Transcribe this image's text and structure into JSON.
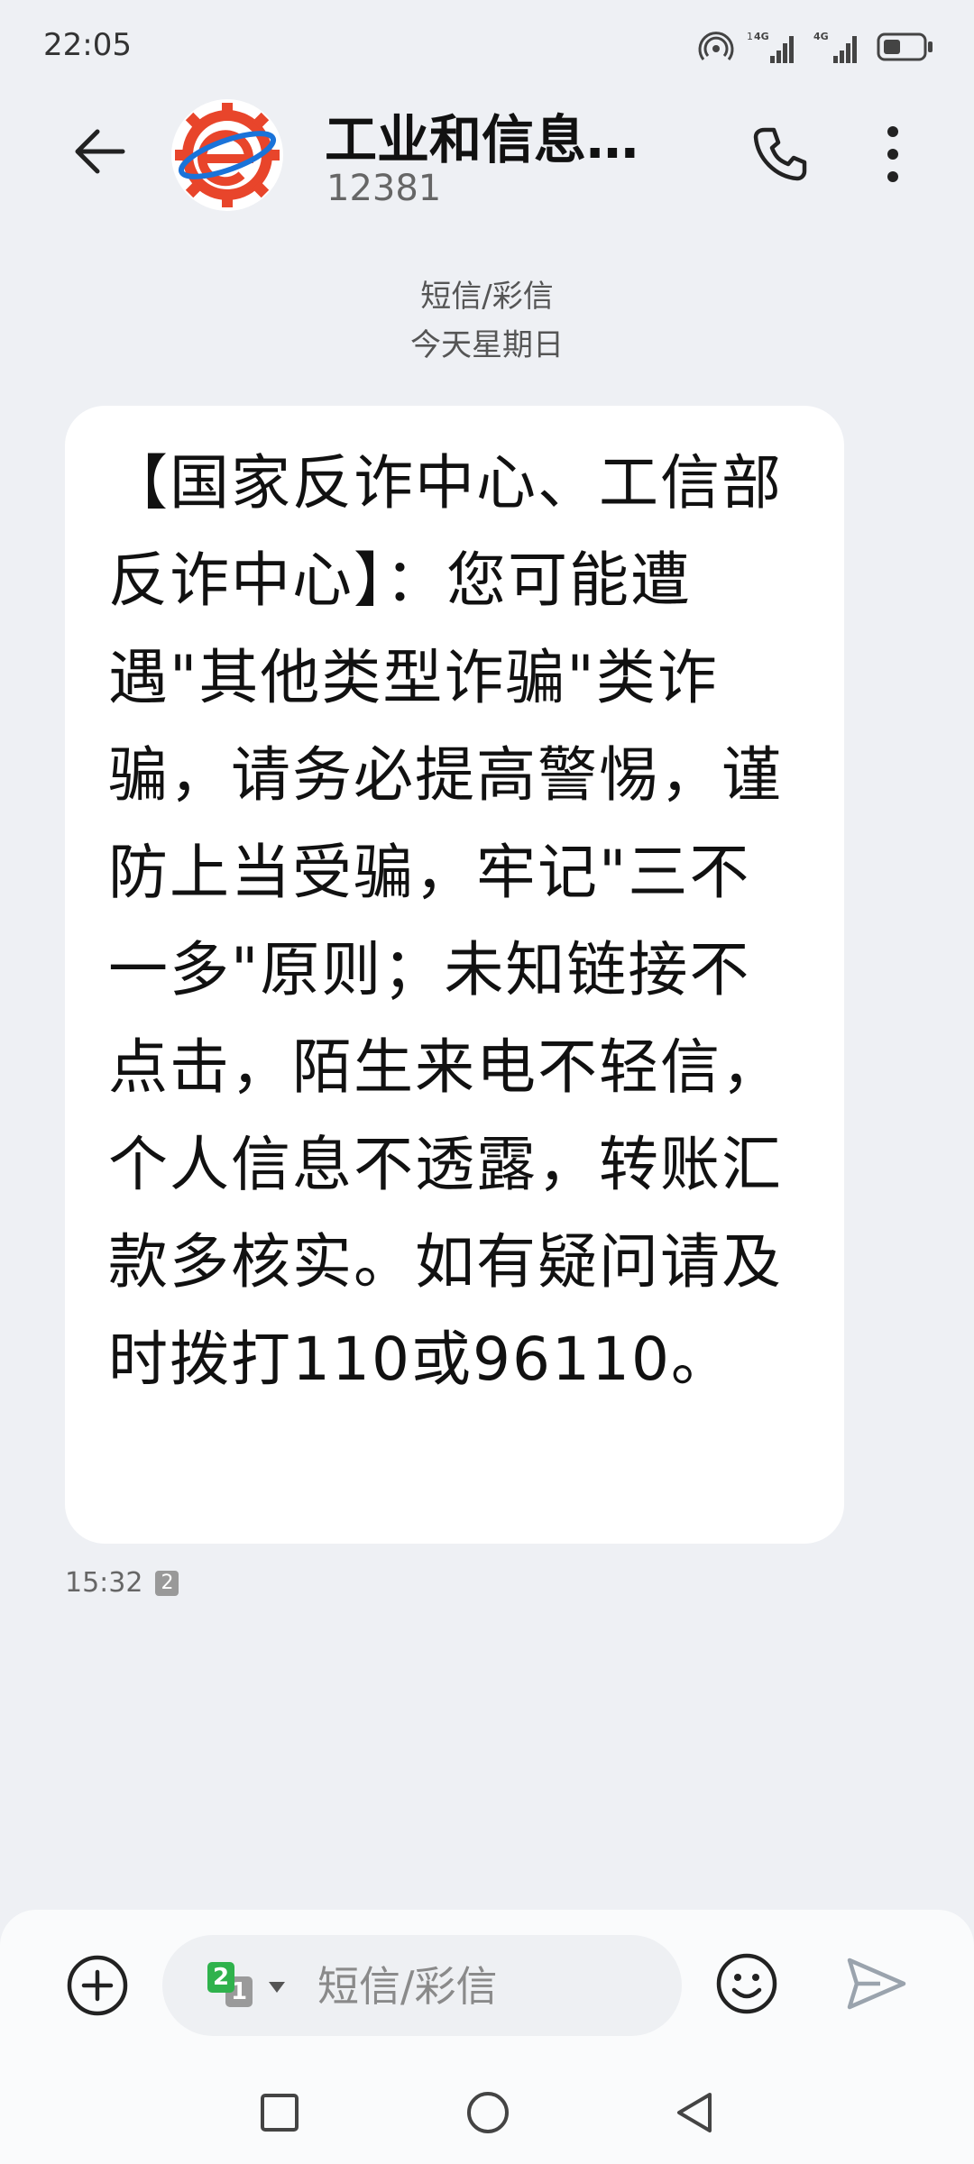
{
  "status_bar": {
    "time": "22:05",
    "icons": [
      "hotspot-icon",
      "signal-4g-sim1-icon",
      "signal-4g-sim2-icon",
      "battery-icon"
    ],
    "signal_labels": [
      "1 4G",
      "4G"
    ]
  },
  "header": {
    "contact_name": "工业和信息化...",
    "contact_number": "12381",
    "avatar_colors": {
      "ring": "#e8452b",
      "accent": "#1a73d9"
    }
  },
  "conversation": {
    "message_type": "短信/彩信",
    "date_label": "今天星期日"
  },
  "message": {
    "text": "【国家反诈中心、工信部反诈中心】：您可能遭遇\"其他类型诈骗\"类诈骗，请务必提高警惕，谨防上当受骗，牢记\"三不一多\"原则；未知链接不点击，陌生来电不轻信，个人信息不透露，转账汇款多核实。如有疑问请及时拨打110或96110。",
    "time": "15:32",
    "sim_badge": "2"
  },
  "composer": {
    "placeholder": "短信/彩信",
    "sim_primary": "2",
    "sim_secondary": "1",
    "sim_primary_color": "#2fb24c",
    "send_color": "#9aa3ad"
  }
}
